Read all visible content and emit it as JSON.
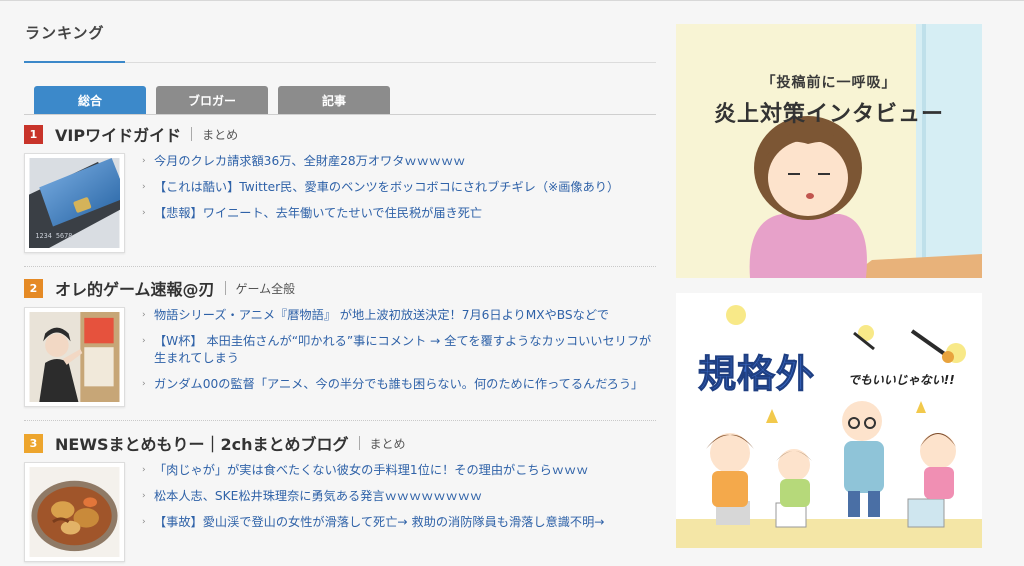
{
  "section": {
    "title": "ランキング"
  },
  "tabs": [
    {
      "label": "総合",
      "active": true
    },
    {
      "label": "ブロガー",
      "active": false
    },
    {
      "label": "記事",
      "active": false
    }
  ],
  "rankings": [
    {
      "number": "1",
      "badge_color": "#c8342a",
      "name": "VIPワイドガイド",
      "category": "まとめ",
      "thumbnail": "credit-card-image",
      "items": [
        "今月のクレカ請求額36万、全財産28万オワタｗｗｗｗｗ",
        "【これは酷い】Twitter民、愛車のベンツをボッコボコにされブチギレ（※画像あり）",
        "【悲報】ワイニート、去年働いてたせいで住民税が届き死亡"
      ]
    },
    {
      "number": "2",
      "badge_color": "#e58a25",
      "name": "オレ的ゲーム速報@刃",
      "category": "ゲーム全般",
      "thumbnail": "anime-character-image",
      "items": [
        "物語シリーズ・アニメ『暦物語』 が地上波初放送決定！7月6日よりMXやBSなどで",
        "【W杯】 本田圭佑さんが“叩かれる”事にコメント → 全てを覆すようなカッコいいセリフが生まれてしまう",
        "ガンダム00の監督「アニメ、今の半分でも誰も困らない。何のために作ってるんだろう」"
      ]
    },
    {
      "number": "3",
      "badge_color": "#eda52d",
      "name": "NEWSまとめもりー｜2chまとめブログ",
      "category": "まとめ",
      "thumbnail": "nikujaga-image",
      "items": [
        "「肉じゃが」が実は食べたくない彼女の手料理1位に！その理由がこちらｗｗｗ",
        "松本人志、SKE松井珠理奈に勇気ある発言ｗｗｗｗｗｗｗｗ",
        "【事故】愛山渓で登山の女性が滑落して死亡→ 救助の消防隊員も滑落し意識不明→"
      ]
    }
  ],
  "ads": [
    {
      "subtitle": "「投稿前に一呼吸」",
      "headline": "炎上対策インタビュー",
      "image": "tired-girl-illustration"
    },
    {
      "logo_text": "規格外",
      "tagline": "でもいいじゃない!!",
      "image": "family-painting-illustration"
    }
  ]
}
